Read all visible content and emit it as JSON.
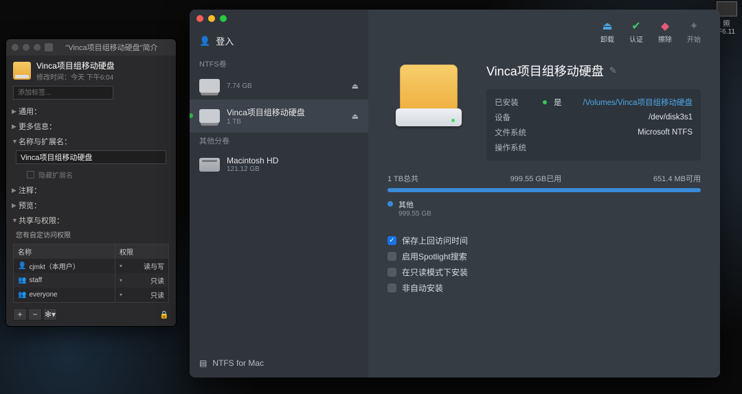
{
  "thumb": {
    "label1": "照",
    "label2": "F6.11"
  },
  "infoWindow": {
    "title": "\"Vinca项目组移动硬盘\"简介",
    "name": "Vinca项目组移动硬盘",
    "modifiedLabel": "修改时间：",
    "modifiedValue": "今天 下午6:04",
    "tagPlaceholder": "添加标签...",
    "sections": {
      "general": "通用：",
      "moreInfo": "更多信息：",
      "nameExt": "名称与扩展名：",
      "comments": "注释：",
      "preview": "预览：",
      "sharing": "共享与权限："
    },
    "nameFieldValue": "Vinca项目组移动硬盘",
    "hideExt": "隐藏扩展名",
    "permNote": "您有自定访问权限",
    "permHeaders": {
      "name": "名称",
      "priv": "权限"
    },
    "permRows": [
      {
        "icon": "person-icon",
        "name": "cjmkt（本用户）",
        "priv": "读与写"
      },
      {
        "icon": "group-icon",
        "name": "staff",
        "priv": "只读"
      },
      {
        "icon": "group-icon",
        "name": "everyone",
        "priv": "只读"
      }
    ]
  },
  "mainWindow": {
    "login": "登入",
    "sidebar": {
      "ntfsLabel": "NTFS卷",
      "otherLabel": "其他分卷",
      "volumes": [
        {
          "name": "",
          "size": "7.74 GB",
          "eject": true,
          "selected": false
        },
        {
          "name": "Vinca项目组移动硬盘",
          "size": "1 TB",
          "eject": true,
          "selected": true
        }
      ],
      "others": [
        {
          "name": "Macintosh HD",
          "size": "121.12 GB"
        }
      ],
      "footer": "NTFS for Mac"
    },
    "toolbar": {
      "unmount": "卸载",
      "verify": "认证",
      "erase": "擦除",
      "start": "开始"
    },
    "title": "Vinca项目组移动硬盘",
    "props": {
      "mountedLabel": "已安装",
      "mountedValue": "是",
      "mountPoint": "/Volumes/Vinca项目组移动硬盘",
      "deviceLabel": "设备",
      "deviceValue": "/dev/disk3s1",
      "fsLabel": "文件系统",
      "fsValue": "Microsoft NTFS",
      "osLabel": "操作系统",
      "osValue": ""
    },
    "usage": {
      "total": "1 TB总共",
      "used": "999.55 GB已用",
      "free": "651.4 MB可用",
      "legendName": "其他",
      "legendSize": "999.55 GB"
    },
    "options": {
      "saveAccess": "保存上回访问时间",
      "spotlight": "启用Spotlight搜索",
      "readonly": "在只读模式下安装",
      "nonauto": "非自动安装"
    }
  }
}
